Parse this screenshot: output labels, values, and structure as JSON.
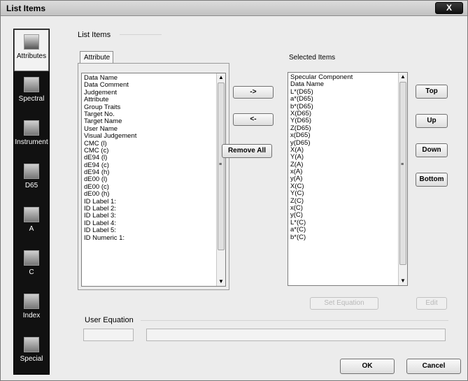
{
  "window": {
    "title": "List Items",
    "close_glyph": "X"
  },
  "sidebar": {
    "items": [
      {
        "label": "Attributes",
        "icon": "attributes-icon",
        "active": true
      },
      {
        "label": "Spectral",
        "icon": "spectral-icon",
        "active": false
      },
      {
        "label": "Instrument",
        "icon": "instrument-icon",
        "active": false
      },
      {
        "label": "D65",
        "icon": "d65-icon",
        "active": false
      },
      {
        "label": "A",
        "icon": "illuminant-a-icon",
        "active": false
      },
      {
        "label": "C",
        "icon": "illuminant-c-icon",
        "active": false
      },
      {
        "label": "Index",
        "icon": "index-icon",
        "active": false
      },
      {
        "label": "Special",
        "icon": "special-icon",
        "active": false
      }
    ]
  },
  "main": {
    "title": "List Items",
    "tab_label": "Attribute",
    "selected_label": "Selected Items",
    "user_equation_label": "User Equation"
  },
  "attribute_list": [
    "Data Name",
    "Data Comment",
    "Judgement",
    "Attribute",
    "Group Traits",
    "Target No.",
    "Target Name",
    "User Name",
    "Visual Judgement",
    "CMC (l)",
    "CMC (c)",
    "dE94 (l)",
    "dE94 (c)",
    "dE94 (h)",
    "dE00 (l)",
    "dE00 (c)",
    "dE00 (h)",
    "ID Label 1:",
    "ID Label 2:",
    "ID Label 3:",
    "ID Label 4:",
    "ID Label 5:",
    "ID Numeric 1:"
  ],
  "selected_list": [
    "Specular Component",
    "Data Name",
    "L*(D65)",
    "a*(D65)",
    "b*(D65)",
    "X(D65)",
    "Y(D65)",
    "Z(D65)",
    "x(D65)",
    "y(D65)",
    "X(A)",
    "Y(A)",
    "Z(A)",
    "x(A)",
    "y(A)",
    "X(C)",
    "Y(C)",
    "Z(C)",
    "x(C)",
    "y(C)",
    "L*(C)",
    "a*(C)",
    "b*(C)"
  ],
  "buttons": {
    "add": "->",
    "remove": "<-",
    "remove_all": "Remove All",
    "top": "Top",
    "up": "Up",
    "down": "Down",
    "bottom": "Bottom",
    "set_equation": "Set Equation",
    "edit": "Edit",
    "ok": "OK",
    "cancel": "Cancel"
  },
  "scroll": {
    "up_glyph": "▲",
    "down_glyph": "▼",
    "grip_glyph": "≡"
  }
}
